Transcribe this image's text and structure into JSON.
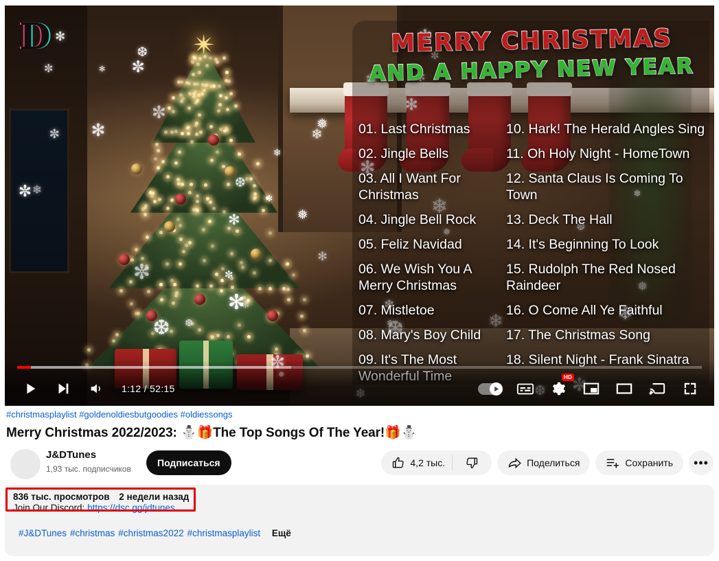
{
  "player": {
    "watermark_logo": "D",
    "time_current": "1:12",
    "time_total": "52:15",
    "time_display": "1:12 / 52:15",
    "progress_percent": 2,
    "quality_badge": "HD",
    "controls": {
      "play": "play-button",
      "next": "next-button",
      "volume": "volume-button",
      "autoplay": "autoplay-toggle",
      "subtitles": "subtitles-button",
      "settings": "settings-button",
      "miniplayer": "miniplayer-button",
      "theater": "theater-button",
      "cast": "cast-button",
      "fullscreen": "fullscreen-button"
    }
  },
  "thumbnail_art": {
    "heading_line1": "MERRY CHRISTMAS",
    "heading_line2": "AND A HAPPY NEW YEAR",
    "heading_color_line1": "#c21a1a",
    "heading_color_line2": "#2db82d",
    "tracks_left": [
      "01. Last Christmas",
      "02. Jingle Bells",
      "03. All I Want For Christmas",
      "04. Jingle Bell Rock",
      "05. Feliz Navidad",
      "06. We Wish You A Merry Christmas",
      "07. Mistletoe",
      "08. Mary's Boy Child",
      "09. It's The Most Wonderful Time"
    ],
    "tracks_right": [
      "10. Hark! The Herald Angles Sing",
      "11. Oh Holy Night - HomeTown",
      "12. Santa Claus Is Coming To Town",
      "13. Deck The Hall",
      "14. It's Beginning To Look",
      "15. Rudolph The  Red Nosed Raindeer",
      "16. O Come All Ye Faithful",
      "17. The Christmas Song",
      "18. Silent Night - Frank Sinatra"
    ]
  },
  "video": {
    "hashtags_above_title": "#christmasplaylist #goldenoldiesbutgoodies #oldiessongs",
    "title": "Merry Christmas 2022/2023: ⛄🎁The Top Songs Of The Year!🎁⛄",
    "title_text": "Merry Christmas 2022/2023:",
    "title_text2": "The Top Songs Of The Year!",
    "title_emoji1": "⛄",
    "title_emoji2": "🎁",
    "title_emoji3": "🎁",
    "title_emoji4": "⛄"
  },
  "channel": {
    "name": "J&DTunes",
    "subscribers": "1,93 тыс. подписчиков",
    "subscribe_label": "Подписаться"
  },
  "actions": {
    "like_count": "4,2 тыс.",
    "share_label": "Поделиться",
    "save_label": "Сохранить",
    "more_label": "•••"
  },
  "description": {
    "views": "836 тыс. просмотров",
    "published": "2 недели назад",
    "discord_text": "Join Our Discord:",
    "discord_link": "https://dsc.gg/jdtunes",
    "tags": [
      "#J&DTunes",
      "#christmas",
      "#christmas2022",
      "#christmasplaylist"
    ],
    "more_label": "Ещё"
  },
  "annotation": {
    "color": "#e00000",
    "target": "views-and-date"
  }
}
